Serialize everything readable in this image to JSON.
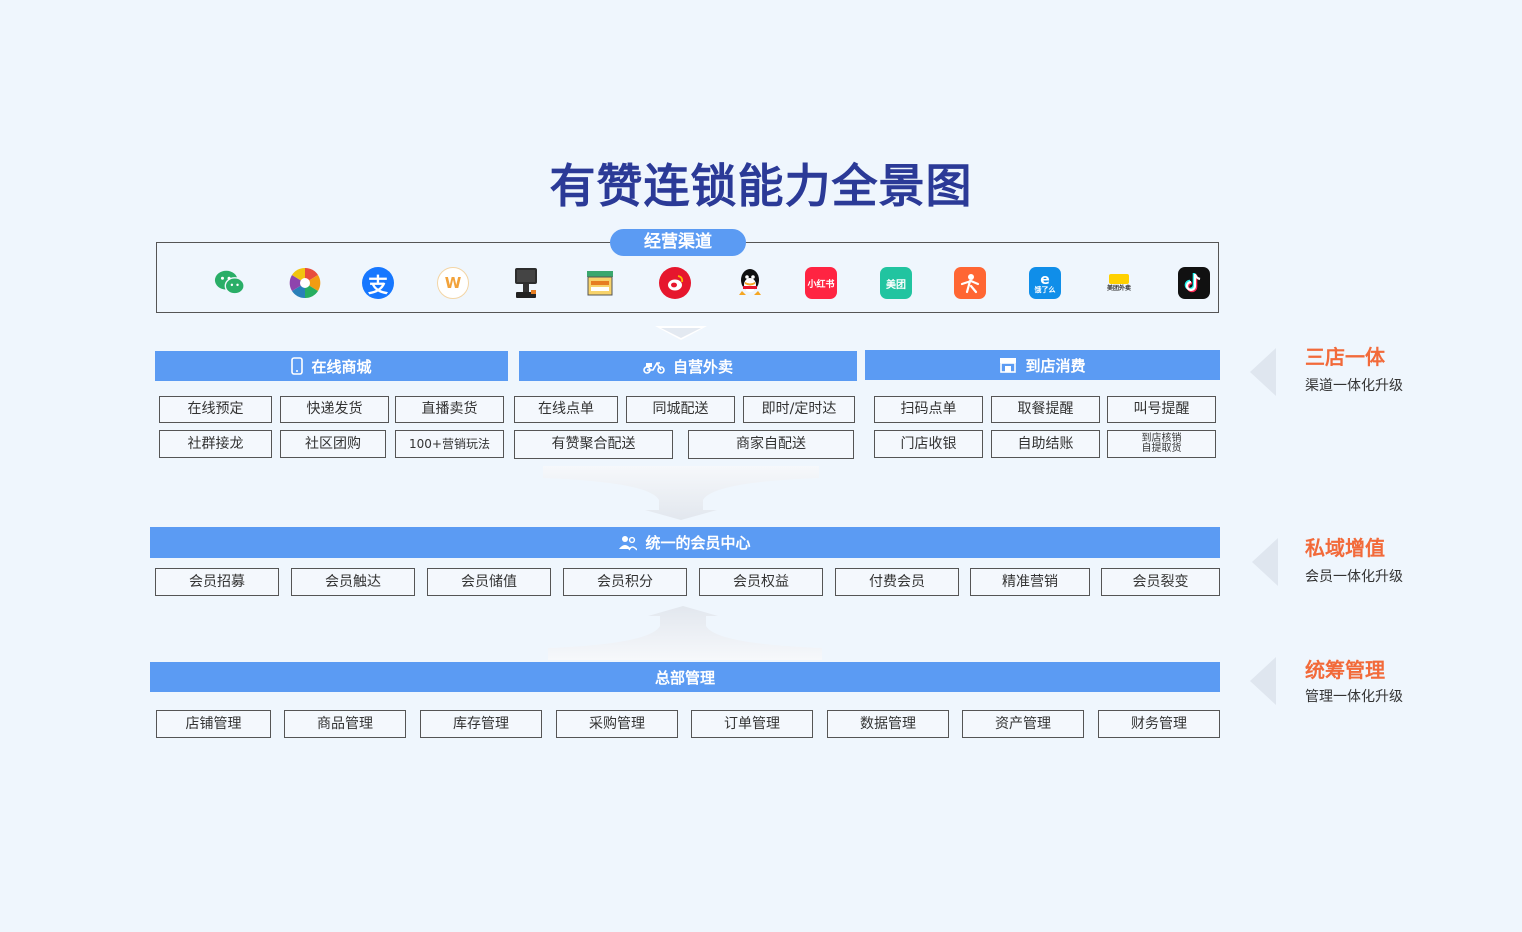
{
  "title": "有赞连锁能力全景图",
  "channel_label": "经营渠道",
  "channel_icons": [
    {
      "name": "wechat-icon",
      "color": "#2aae67",
      "glyph": ""
    },
    {
      "name": "mini-program-icon",
      "color": "#eef3f9",
      "glyph": ""
    },
    {
      "name": "alipay-icon",
      "color": "#1677ff",
      "glyph": "支"
    },
    {
      "name": "youzan-weibo-icon",
      "color": "#ffffff",
      "glyph": "W"
    },
    {
      "name": "pos-terminal-icon",
      "color": "#2d2d2d",
      "glyph": ""
    },
    {
      "name": "store-shop-icon",
      "color": "#f2a23a",
      "glyph": ""
    },
    {
      "name": "weibo-icon",
      "color": "#e6162d",
      "glyph": ""
    },
    {
      "name": "qq-icon",
      "color": "#222222",
      "glyph": ""
    },
    {
      "name": "xiaohongshu-icon",
      "color": "#ff2442",
      "glyph": "小红书"
    },
    {
      "name": "meituan-icon",
      "color": "#21c4a0",
      "glyph": "美团"
    },
    {
      "name": "dianping-icon",
      "color": "#ff6633",
      "glyph": ""
    },
    {
      "name": "eleme-icon",
      "color": "#0f8ee9",
      "glyph": "饿了么"
    },
    {
      "name": "meituan-waimai-icon",
      "color": "#ffd100",
      "glyph": "美团外卖"
    },
    {
      "name": "douyin-icon",
      "color": "#111111",
      "glyph": ""
    }
  ],
  "sections": {
    "online_mall": {
      "label": "在线商城",
      "items": [
        "在线预定",
        "快递发货",
        "直播卖货",
        "社群接龙",
        "社区团购",
        "100+营销玩法"
      ]
    },
    "delivery": {
      "label": "自营外卖",
      "items": [
        "在线点单",
        "同城配送",
        "即时/定时达",
        "有赞聚合配送",
        "商家自配送"
      ]
    },
    "in_store": {
      "label": "到店消费",
      "items": [
        "扫码点单",
        "取餐提醒",
        "叫号提醒",
        "门店收银",
        "自助结账",
        "到店核销",
        "自提取货"
      ]
    },
    "member_center": {
      "label": "统一的会员中心",
      "items": [
        "会员招募",
        "会员触达",
        "会员储值",
        "会员积分",
        "会员权益",
        "付费会员",
        "精准营销",
        "会员裂变"
      ]
    },
    "hq_management": {
      "label": "总部管理",
      "items": [
        "店铺管理",
        "商品管理",
        "库存管理",
        "采购管理",
        "订单管理",
        "数据管理",
        "资产管理",
        "财务管理"
      ]
    }
  },
  "side_labels": [
    {
      "title": "三店一体",
      "subtitle": "渠道一体化升级"
    },
    {
      "title": "私域增值",
      "subtitle": "会员一体化升级"
    },
    {
      "title": "统筹管理",
      "subtitle": "管理一体化升级"
    }
  ],
  "colors": {
    "bar": "#5b9bf3",
    "title": "#2b3a97",
    "accent": "#f26a3a"
  }
}
